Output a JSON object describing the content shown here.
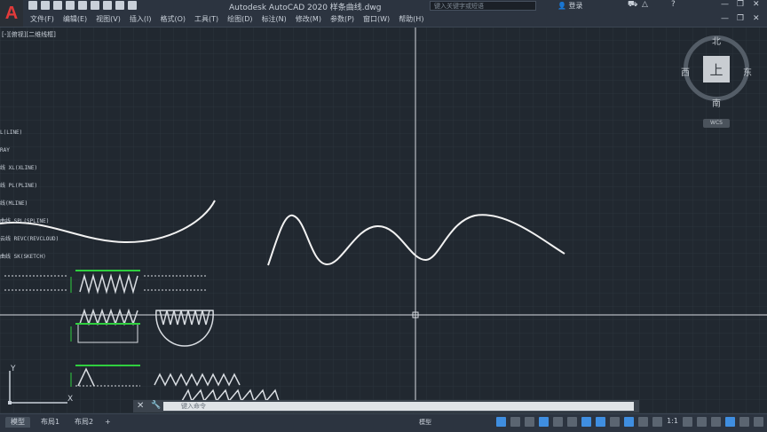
{
  "app": {
    "title": "Autodesk AutoCAD 2020    样条曲线.dwg",
    "logo": "A",
    "search_placeholder": "键入关键字或短语",
    "login": "登录"
  },
  "menu": [
    "文件(F)",
    "编辑(E)",
    "视图(V)",
    "插入(I)",
    "格式(O)",
    "工具(T)",
    "绘图(D)",
    "标注(N)",
    "修改(M)",
    "参数(P)",
    "窗口(W)",
    "帮助(H)"
  ],
  "viewport_label": "[-][俯视][二维线框]",
  "viewcube": {
    "top": "上",
    "north": "北",
    "south": "南",
    "east": "东",
    "west": "西",
    "wcs": "WCS"
  },
  "command_list": [
    "L(LINE)",
    "RAY",
    "线 XL(XLINE)",
    "线 PL(PLINE)",
    "线(MLINE)",
    "曲线 SPL(SPLINE)",
    "云线 REVC(REVCLOUD)",
    "曲线 SK(SKETCH)"
  ],
  "ucs": {
    "x": "X",
    "y": "Y"
  },
  "cmdline": {
    "close": "✕",
    "placeholder": "键入命令"
  },
  "status": {
    "tabs": [
      "模型",
      "布局1",
      "布局2"
    ],
    "add": "+",
    "model": "模型",
    "scale": "1:1"
  },
  "colors": {
    "background": "#212830",
    "curve": "#f2f2f2",
    "accent_green": "#2fcf3f",
    "accent_red": "#e23a3a"
  }
}
